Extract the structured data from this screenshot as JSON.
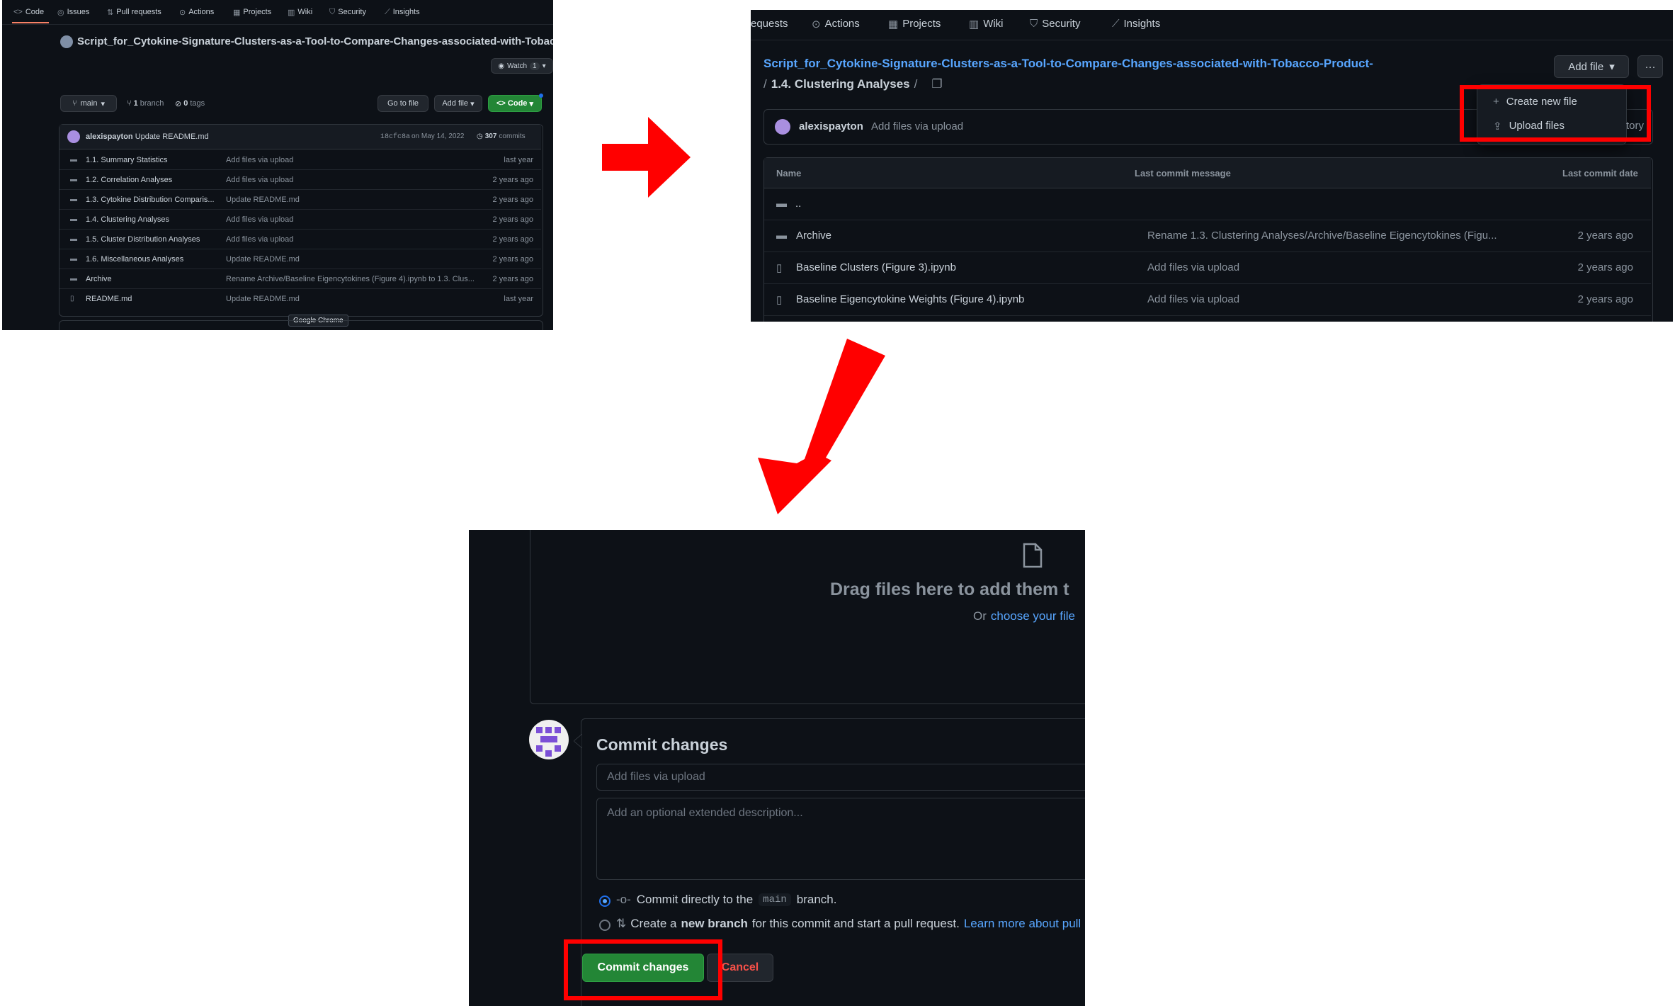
{
  "panel1": {
    "tabs": [
      "Code",
      "Issues",
      "Pull requests",
      "Actions",
      "Projects",
      "Wiki",
      "Security",
      "Insights"
    ],
    "repo_title": "Script_for_Cytokine-Signature-Clusters-as-a-Tool-to-Compare-Changes-associated-with-Tobacco",
    "watch_label": "Watch",
    "watch_count": "1",
    "branch_button": "main",
    "branch_count": "1",
    "branch_label": "branch",
    "tags_count": "0",
    "tags_label": "tags",
    "go_to_file": "Go to file",
    "add_file": "Add file",
    "code_button": "Code",
    "commit_user": "alexispayton",
    "commit_message": "Update README.md",
    "commit_hash": "18cfc8a",
    "commit_date": "on May 14, 2022",
    "commits_count": "307",
    "commits_label": "commits",
    "files": [
      {
        "name": "1.1. Summary Statistics",
        "message": "Add files via upload",
        "date": "last year"
      },
      {
        "name": "1.2. Correlation Analyses",
        "message": "Add files via upload",
        "date": "2 years ago"
      },
      {
        "name": "1.3. Cytokine Distribution Comparis...",
        "message": "Update README.md",
        "date": "2 years ago"
      },
      {
        "name": "1.4. Clustering Analyses",
        "message": "Add files via upload",
        "date": "2 years ago"
      },
      {
        "name": "1.5. Cluster Distribution Analyses",
        "message": "Add files via upload",
        "date": "2 years ago"
      },
      {
        "name": "1.6. Miscellaneous Analyses",
        "message": "Update README.md",
        "date": "2 years ago"
      },
      {
        "name": "Archive",
        "message": "Rename Archive/Baseline Eigencytokines (Figure 4).ipynb to 1.3. Clus...",
        "date": "2 years ago"
      },
      {
        "name": "README.md",
        "message": "Update README.md",
        "date": "last year"
      }
    ],
    "tooltip": "Google Chrome"
  },
  "panel2": {
    "tabs": [
      "equests",
      "Actions",
      "Projects",
      "Wiki",
      "Security",
      "Insights"
    ],
    "repo_link": "Script_for_Cytokine-Signature-Clusters-as-a-Tool-to-Compare-Changes-associated-with-Tobacco-Product-",
    "path": "1.4. Clustering Analyses",
    "add_file": "Add file",
    "menu": [
      "Create new file",
      "Upload files"
    ],
    "menu_tail": "tory",
    "commit_user": "alexispayton",
    "commit_message": "Add files via upload",
    "columns": [
      "Name",
      "Last commit message",
      "Last commit date"
    ],
    "parent_dir": "..",
    "files": [
      {
        "name": "Archive",
        "message": "Rename 1.3. Clustering Analyses/Archive/Baseline Eigencytokines (Figu...",
        "date": "2 years ago"
      },
      {
        "name": "Baseline Clusters (Figure 3).ipynb",
        "message": "Add files via upload",
        "date": "2 years ago"
      },
      {
        "name": "Baseline Eigencytokine Weights (Figure 4).ipynb",
        "message": "Add files via upload",
        "date": "2 years ago"
      }
    ]
  },
  "panel3": {
    "drop_title": "Drag files here to add them t",
    "drop_or": "Or",
    "drop_link": "choose your file",
    "commit_heading": "Commit changes",
    "summary_placeholder": "Add files via upload",
    "description_placeholder": "Add an optional extended description...",
    "option1_pre": "Commit directly to the",
    "option1_branch": "main",
    "option1_post": "branch.",
    "option2_pre": "Create a",
    "option2_bold": "new branch",
    "option2_post": "for this commit and start a pull request.",
    "option2_link": "Learn more about pull",
    "commit_button": "Commit changes",
    "cancel_button": "Cancel"
  },
  "colors": {
    "arrow": "#ff0000",
    "highlight": "#ff0000",
    "bg": "#0d1117",
    "link": "#58a6ff",
    "green": "#238636"
  }
}
